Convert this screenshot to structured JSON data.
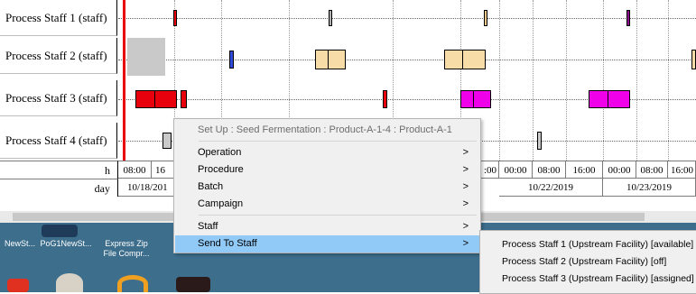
{
  "gantt": {
    "rows": [
      {
        "label": "Process Staff 1 (staff)"
      },
      {
        "label": "Process Staff 2 (staff)"
      },
      {
        "label": "Process Staff 3 (staff)"
      },
      {
        "label": "Process Staff 4 (staff)"
      }
    ],
    "scale": {
      "hour_label": "h",
      "day_label": "day",
      "hours": [
        "08:00",
        "16",
        "",
        "",
        "",
        "",
        "",
        ":00",
        "00:00",
        "08:00",
        "16:00",
        "00:00",
        "08:00",
        "16:00"
      ],
      "days": [
        "10/18/201",
        "",
        "",
        "10/22/2019",
        "10/23/2019"
      ]
    },
    "colors": {
      "red": "#e8000c",
      "orange": "#f5c98a",
      "yellow": "#f8dca8",
      "magenta": "#f000e8",
      "blue": "#2f4ad9",
      "purple": "#8a0f8a",
      "gray": "#c9c9c9"
    }
  },
  "context_menu": {
    "header": "Set Up : Seed Fermentation : Product-A-1-4 : Product-A-1",
    "items": [
      {
        "label": "Operation",
        "arrow": ">"
      },
      {
        "label": "Procedure",
        "arrow": ">"
      },
      {
        "label": "Batch",
        "arrow": ">"
      },
      {
        "label": "Campaign",
        "arrow": ">"
      },
      {
        "label": "Staff",
        "arrow": ">"
      },
      {
        "label": "Send To Staff",
        "arrow": ">"
      }
    ]
  },
  "submenu": {
    "items": [
      "Process Staff 1 (Upstream Facility) [available]",
      "Process Staff 2 (Upstream Facility) [off]",
      "Process Staff 3 (Upstream Facility) [assigned]"
    ]
  },
  "taskbar": {
    "items": [
      {
        "label": "NewSt..."
      },
      {
        "label": "PoG1NewSt..."
      },
      {
        "label": "Express Zip"
      },
      {
        "label": "File Compr..."
      }
    ]
  }
}
